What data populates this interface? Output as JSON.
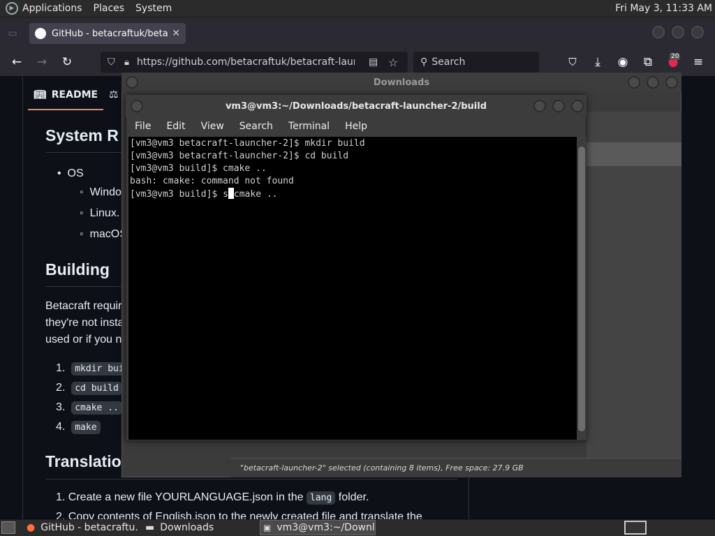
{
  "top_panel": {
    "menus": [
      "Applications",
      "Places",
      "System"
    ],
    "clock": "Fri May  3, 11:33 AM"
  },
  "firefox": {
    "tab_title": "GitHub - betacraftuk/betac",
    "url": "https://github.com/betacraftuk/betacraft-launcher",
    "search_placeholder": "Search",
    "ext_badge": "20"
  },
  "readme": {
    "tab_label": "README",
    "h_system": "System R",
    "os_label": "OS",
    "os_items": [
      "Windo",
      "Linux.",
      "macOS"
    ],
    "h_building": "Building",
    "para_lines": [
      "Betacraft requir",
      "they're not insta",
      "used or if you n"
    ],
    "steps": [
      "mkdir bui",
      "cd build",
      "cmake ..",
      "make"
    ],
    "h_translation": "Translatio",
    "trans_item1_a": "Create a new file YOURLANGUAGE.json in the",
    "trans_item1_code": "lang",
    "trans_item1_b": "folder.",
    "trans_item2": "Copy contents of English.json to the newly created file and translate the"
  },
  "nautilus": {
    "title": "Downloads",
    "status": "\"betacraft-launcher-2\" selected (containing 8 items), Free space: 27.9 GB"
  },
  "terminal": {
    "title": "vm3@vm3:~/Downloads/betacraft-launcher-2/build",
    "menu": [
      "File",
      "Edit",
      "View",
      "Search",
      "Terminal",
      "Help"
    ],
    "lines": [
      "[vm3@vm3 betacraft-launcher-2]$ mkdir build",
      "[vm3@vm3 betacraft-launcher-2]$ cd build",
      "[vm3@vm3 build]$ cmake ..",
      "bash: cmake: command not found"
    ],
    "prompt": "[vm3@vm3 build]$ ",
    "before_cursor": "s",
    "after_cursor": "cmake .."
  },
  "taskbar": {
    "items": [
      "GitHub - betacraftu...",
      "Downloads",
      "vm3@vm3:~/Downl..."
    ]
  }
}
